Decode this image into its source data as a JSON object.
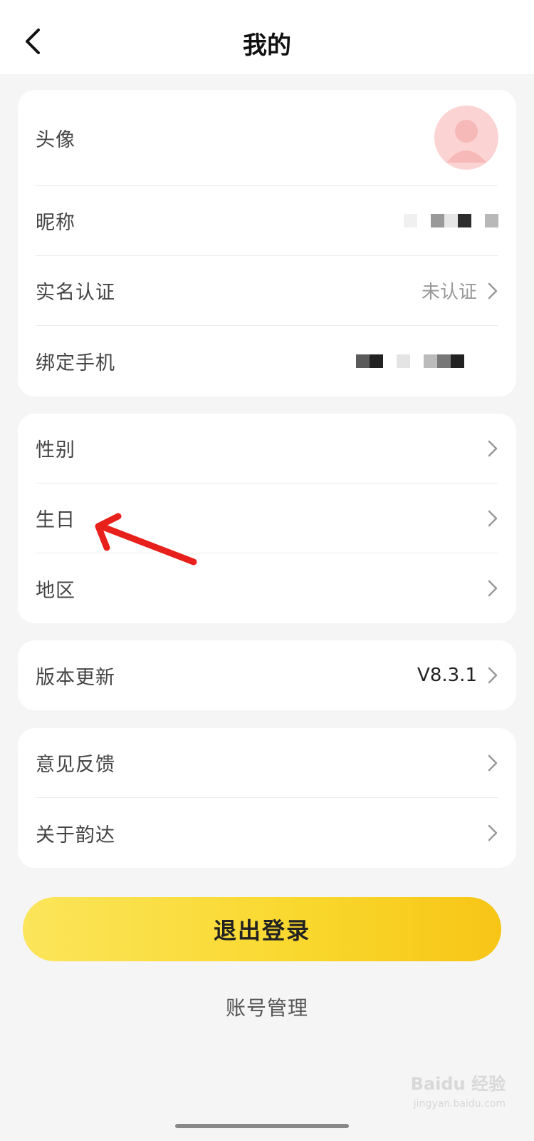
{
  "header": {
    "title": "我的"
  },
  "profile_card": {
    "avatar_label": "头像",
    "nickname_label": "昵称",
    "realname_label": "实名认证",
    "realname_value": "未认证",
    "phone_label": "绑定手机"
  },
  "info_card": {
    "gender_label": "性别",
    "birthday_label": "生日",
    "region_label": "地区"
  },
  "version_card": {
    "update_label": "版本更新",
    "version_value": "V8.3.1"
  },
  "misc_card": {
    "feedback_label": "意见反馈",
    "about_label": "关于韵达"
  },
  "logout_label": "退出登录",
  "account_manage_label": "账号管理",
  "watermark": {
    "brand": "Baidu 经验",
    "url": "jingyan.baidu.com"
  },
  "colors": {
    "accent": "#f9d72c",
    "annotation": "#e8201b",
    "avatar_bg": "#fbd3d3"
  }
}
